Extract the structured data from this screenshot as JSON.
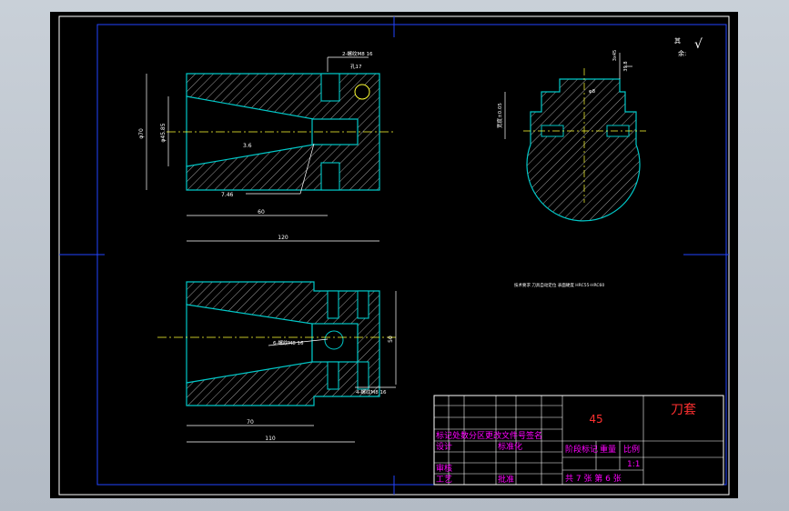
{
  "colors": {
    "background": "#000000",
    "frame": "#ffffff",
    "outline": "#00c8c8",
    "hatch": "#c8c8c8",
    "centerline": "#ffff33",
    "dimension": "#ffffff",
    "title_text": "#ff00ff",
    "part_name": "#ff3030",
    "grid_marks": "#2244ff"
  },
  "dimensions": {
    "top_view": {
      "overall_length": "120",
      "inner_length": "60",
      "outer_diameter": "φ70",
      "inner_diameter": "φ45.85",
      "taper_angle": "3.6",
      "ra": "7.46",
      "threaded_hole": "2-螺纹M8 16",
      "hole_depth": "孔17"
    },
    "bottom_view": {
      "overall_length": "110",
      "inner_length": "70",
      "height": "50",
      "threaded_hole_left": "6-螺纹M8 16",
      "threaded_hole_right": "4-螺纹M8 16"
    },
    "section_view": {
      "height": "39.8",
      "width_label": "宽度±0.05",
      "small_label": "φ8",
      "top_note": "3x45"
    }
  },
  "roughness": {
    "label_other": "其",
    "label_rest": "余:",
    "symbol": "√"
  },
  "notes": {
    "technical_note": "技术要求  刀具自动定位   表面硬度 HRC55-HRC60"
  },
  "title_block": {
    "material": "45",
    "part_name": "刀套",
    "header_row": "标记处数分区更改文件号签名",
    "designer_label": "设计",
    "designer_name": "标准化",
    "checker_label": "审核",
    "process_label": "工艺",
    "approver_label": "批准",
    "stage_mark": "阶段标记",
    "weight": "重量",
    "scale_label": "比例",
    "scale_value": "1:1",
    "sheet_info": "共 7 张  第 6 张"
  }
}
